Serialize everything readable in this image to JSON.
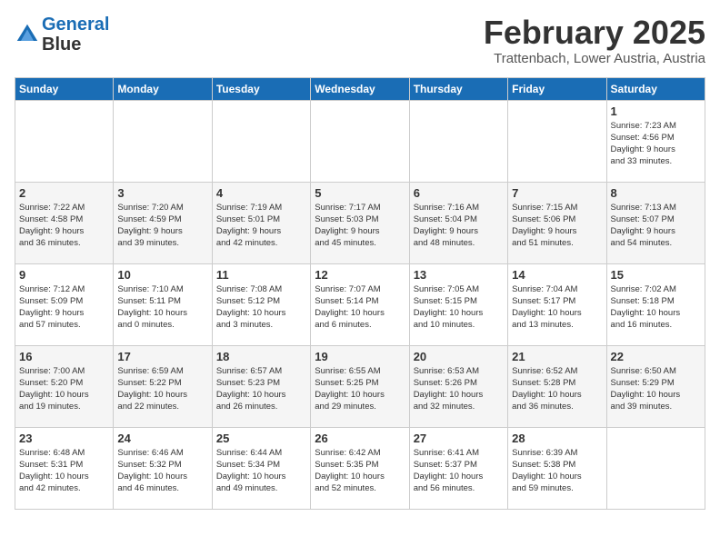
{
  "header": {
    "logo_line1": "General",
    "logo_line2": "Blue",
    "month_title": "February 2025",
    "location": "Trattenbach, Lower Austria, Austria"
  },
  "days_of_week": [
    "Sunday",
    "Monday",
    "Tuesday",
    "Wednesday",
    "Thursday",
    "Friday",
    "Saturday"
  ],
  "weeks": [
    [
      {
        "day": "",
        "info": ""
      },
      {
        "day": "",
        "info": ""
      },
      {
        "day": "",
        "info": ""
      },
      {
        "day": "",
        "info": ""
      },
      {
        "day": "",
        "info": ""
      },
      {
        "day": "",
        "info": ""
      },
      {
        "day": "1",
        "info": "Sunrise: 7:23 AM\nSunset: 4:56 PM\nDaylight: 9 hours\nand 33 minutes."
      }
    ],
    [
      {
        "day": "2",
        "info": "Sunrise: 7:22 AM\nSunset: 4:58 PM\nDaylight: 9 hours\nand 36 minutes."
      },
      {
        "day": "3",
        "info": "Sunrise: 7:20 AM\nSunset: 4:59 PM\nDaylight: 9 hours\nand 39 minutes."
      },
      {
        "day": "4",
        "info": "Sunrise: 7:19 AM\nSunset: 5:01 PM\nDaylight: 9 hours\nand 42 minutes."
      },
      {
        "day": "5",
        "info": "Sunrise: 7:17 AM\nSunset: 5:03 PM\nDaylight: 9 hours\nand 45 minutes."
      },
      {
        "day": "6",
        "info": "Sunrise: 7:16 AM\nSunset: 5:04 PM\nDaylight: 9 hours\nand 48 minutes."
      },
      {
        "day": "7",
        "info": "Sunrise: 7:15 AM\nSunset: 5:06 PM\nDaylight: 9 hours\nand 51 minutes."
      },
      {
        "day": "8",
        "info": "Sunrise: 7:13 AM\nSunset: 5:07 PM\nDaylight: 9 hours\nand 54 minutes."
      }
    ],
    [
      {
        "day": "9",
        "info": "Sunrise: 7:12 AM\nSunset: 5:09 PM\nDaylight: 9 hours\nand 57 minutes."
      },
      {
        "day": "10",
        "info": "Sunrise: 7:10 AM\nSunset: 5:11 PM\nDaylight: 10 hours\nand 0 minutes."
      },
      {
        "day": "11",
        "info": "Sunrise: 7:08 AM\nSunset: 5:12 PM\nDaylight: 10 hours\nand 3 minutes."
      },
      {
        "day": "12",
        "info": "Sunrise: 7:07 AM\nSunset: 5:14 PM\nDaylight: 10 hours\nand 6 minutes."
      },
      {
        "day": "13",
        "info": "Sunrise: 7:05 AM\nSunset: 5:15 PM\nDaylight: 10 hours\nand 10 minutes."
      },
      {
        "day": "14",
        "info": "Sunrise: 7:04 AM\nSunset: 5:17 PM\nDaylight: 10 hours\nand 13 minutes."
      },
      {
        "day": "15",
        "info": "Sunrise: 7:02 AM\nSunset: 5:18 PM\nDaylight: 10 hours\nand 16 minutes."
      }
    ],
    [
      {
        "day": "16",
        "info": "Sunrise: 7:00 AM\nSunset: 5:20 PM\nDaylight: 10 hours\nand 19 minutes."
      },
      {
        "day": "17",
        "info": "Sunrise: 6:59 AM\nSunset: 5:22 PM\nDaylight: 10 hours\nand 22 minutes."
      },
      {
        "day": "18",
        "info": "Sunrise: 6:57 AM\nSunset: 5:23 PM\nDaylight: 10 hours\nand 26 minutes."
      },
      {
        "day": "19",
        "info": "Sunrise: 6:55 AM\nSunset: 5:25 PM\nDaylight: 10 hours\nand 29 minutes."
      },
      {
        "day": "20",
        "info": "Sunrise: 6:53 AM\nSunset: 5:26 PM\nDaylight: 10 hours\nand 32 minutes."
      },
      {
        "day": "21",
        "info": "Sunrise: 6:52 AM\nSunset: 5:28 PM\nDaylight: 10 hours\nand 36 minutes."
      },
      {
        "day": "22",
        "info": "Sunrise: 6:50 AM\nSunset: 5:29 PM\nDaylight: 10 hours\nand 39 minutes."
      }
    ],
    [
      {
        "day": "23",
        "info": "Sunrise: 6:48 AM\nSunset: 5:31 PM\nDaylight: 10 hours\nand 42 minutes."
      },
      {
        "day": "24",
        "info": "Sunrise: 6:46 AM\nSunset: 5:32 PM\nDaylight: 10 hours\nand 46 minutes."
      },
      {
        "day": "25",
        "info": "Sunrise: 6:44 AM\nSunset: 5:34 PM\nDaylight: 10 hours\nand 49 minutes."
      },
      {
        "day": "26",
        "info": "Sunrise: 6:42 AM\nSunset: 5:35 PM\nDaylight: 10 hours\nand 52 minutes."
      },
      {
        "day": "27",
        "info": "Sunrise: 6:41 AM\nSunset: 5:37 PM\nDaylight: 10 hours\nand 56 minutes."
      },
      {
        "day": "28",
        "info": "Sunrise: 6:39 AM\nSunset: 5:38 PM\nDaylight: 10 hours\nand 59 minutes."
      },
      {
        "day": "",
        "info": ""
      }
    ]
  ]
}
